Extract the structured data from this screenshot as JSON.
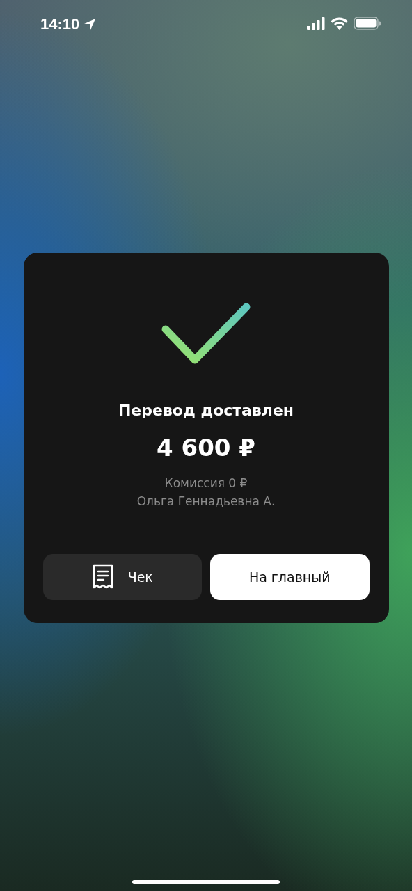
{
  "status_bar": {
    "time": "14:10"
  },
  "result": {
    "title": "Перевод доставлен",
    "amount": "4 600 ₽",
    "details": [
      "Комиссия 0 ₽",
      "Ольга Геннадьевна А."
    ]
  },
  "buttons": [
    {
      "kind": "receipt",
      "label": "Чек"
    },
    {
      "kind": "primary",
      "label": "На главный"
    }
  ]
}
